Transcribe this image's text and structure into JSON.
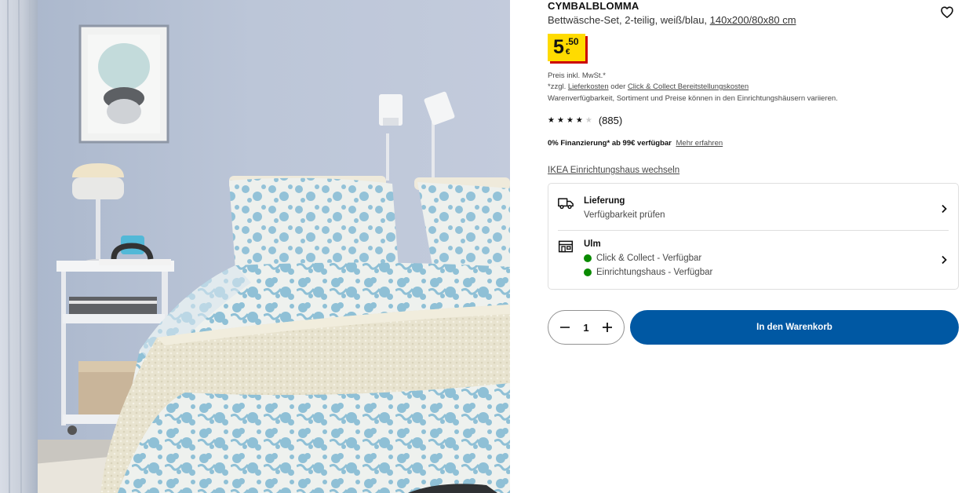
{
  "product": {
    "name": "CYMBALBLOMMA",
    "description": "Bettwäsche-Set, 2-teilig, weiß/blau,",
    "measure": "140x200/80x80 cm",
    "image_icon": "bedroom-product-photo"
  },
  "price": {
    "integer": "5",
    "decimal": ".50",
    "currency": "€",
    "badge_color": "#ffdb00",
    "shadow_color": "#cc0008"
  },
  "legal": {
    "line1": "Preis inkl. MwSt.*",
    "line2_prefix": "*zzgl.",
    "line2_link1": "Lieferkosten",
    "line2_mid": "oder",
    "line2_link2": "Click & Collect Bereitstellungskosten",
    "line3": "Warenverfügbarkeit, Sortiment und Preise können in den Einrichtungshäusern variieren."
  },
  "rating": {
    "value": 3.5,
    "max": 5,
    "count": "(885)"
  },
  "finance": {
    "text": "0% Finanzierung* ab 99€ verfügbar",
    "link": "Mehr erfahren"
  },
  "store_change": "IKEA Einrichtungshaus wechseln",
  "availability": {
    "delivery": {
      "title": "Lieferung",
      "subtitle": "Verfügbarkeit prüfen",
      "icon": "truck-icon"
    },
    "store": {
      "title": "Ulm",
      "icon": "store-icon",
      "click_collect": "Click & Collect - Verfügbar",
      "instore": "Einrichtungshaus - Verfügbar",
      "status_color": "#0a8a00"
    }
  },
  "quantity": {
    "value": "1"
  },
  "cart_button": {
    "label": "In den Warenkorb",
    "color": "#0058a3"
  }
}
